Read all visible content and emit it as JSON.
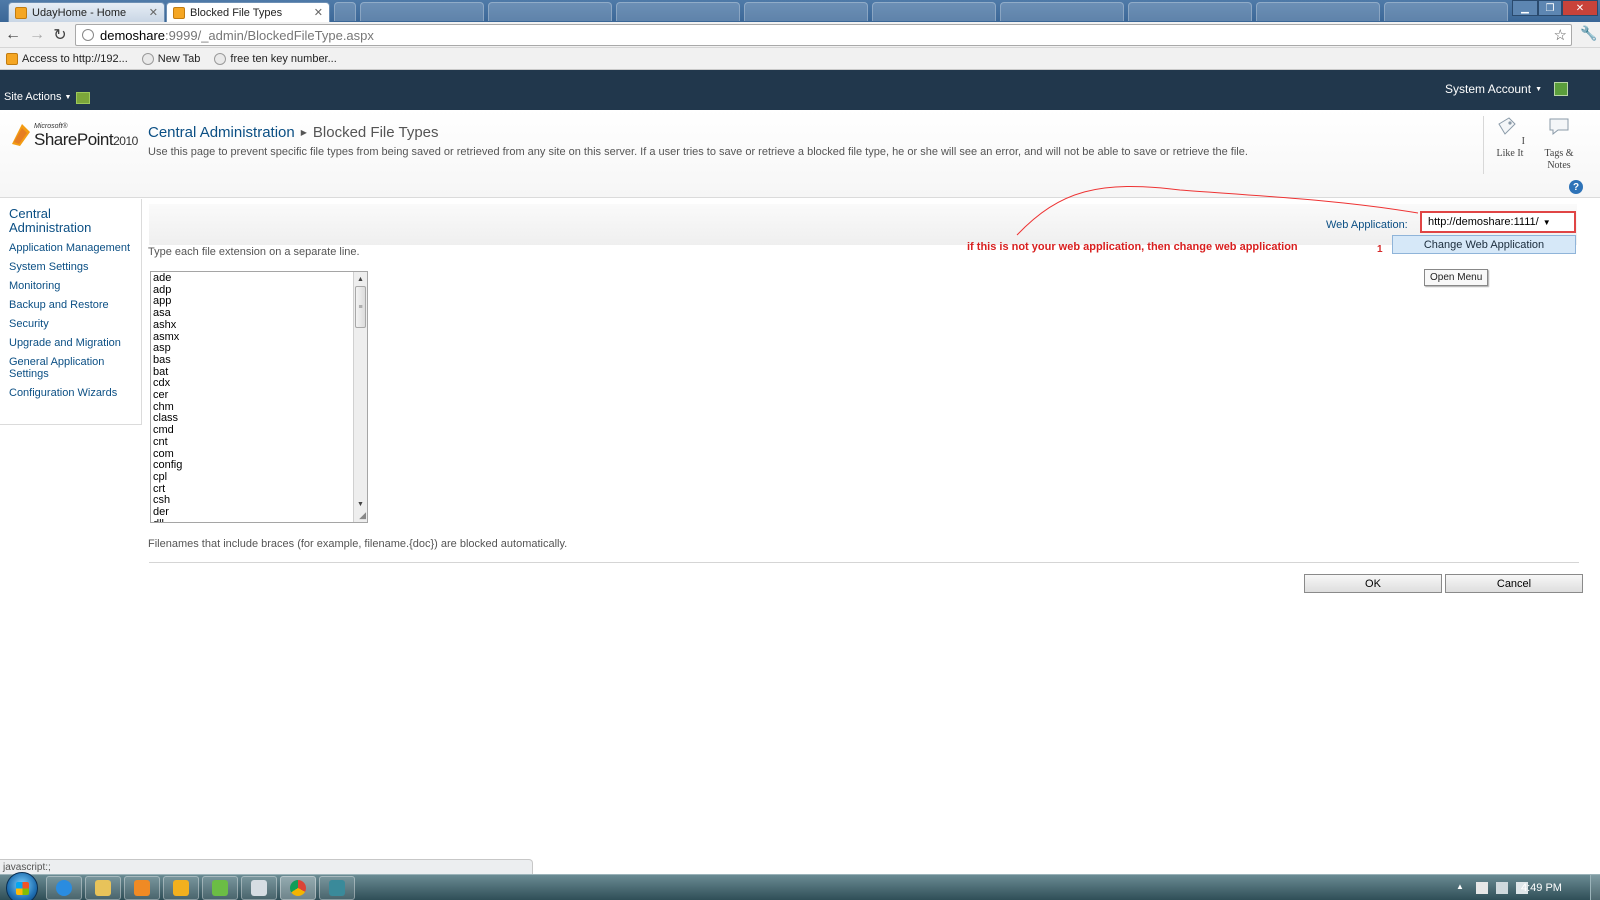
{
  "browser": {
    "tabs": [
      {
        "label": "UdayHome - Home",
        "active": false
      },
      {
        "label": "Blocked File Types",
        "active": true
      }
    ],
    "url_host": "demoshare",
    "url_path": ":9999/_admin/BlockedFileType.aspx",
    "bookmarks": [
      "Access to http://192...",
      "New Tab",
      "free ten key number..."
    ],
    "icons": {
      "back": "back-arrow-icon",
      "forward": "forward-arrow-icon",
      "reload": "reload-icon",
      "star": "star-icon",
      "wrench": "wrench-icon"
    }
  },
  "ribbon": {
    "site_actions": "Site Actions",
    "account": "System Account"
  },
  "header": {
    "logo_ms": "Microsoft®",
    "logo_sp": "SharePoint",
    "logo_year": "2010",
    "crumb_root": "Central Administration",
    "crumb_page": "Blocked File Types",
    "description": "Use this page to prevent specific file types from being saved or retrieved from any site on this server. If a user tries to save or retrieve a blocked file type, he or she will see an error, and will not be able to save or retrieve the file.",
    "i_like_it": "I Like It",
    "tags_line1": "Tags &",
    "tags_line2": "Notes",
    "help": "?"
  },
  "leftnav": {
    "heading_line1": "Central",
    "heading_line2": "Administration",
    "items": [
      "Application Management",
      "System Settings",
      "Monitoring",
      "Backup and Restore",
      "Security",
      "Upgrade and Migration",
      "General Application",
      "Settings",
      "Configuration Wizards"
    ]
  },
  "main": {
    "webapp_label": "Web Application:",
    "webapp_value": "http://demoshare:1111/",
    "menu_number": "1",
    "change_webapp": "Change Web Application",
    "open_menu": "Open Menu",
    "annotation": "if this is not your web application, then change web application",
    "instruction": "Type each file extension on a separate line.",
    "extensions": [
      "ade",
      "adp",
      "app",
      "asa",
      "ashx",
      "asmx",
      "asp",
      "bas",
      "bat",
      "cdx",
      "cer",
      "chm",
      "class",
      "cmd",
      "cnt",
      "com",
      "config",
      "cpl",
      "crt",
      "csh",
      "der",
      "dll"
    ],
    "braces_note": "Filenames that include braces (for example, filename.{doc}) are blocked automatically.",
    "ok": "OK",
    "cancel": "Cancel"
  },
  "status": {
    "text": "javascript:;"
  },
  "taskbar": {
    "clock": "4:49 PM"
  },
  "colors": {
    "ribbon": "#21374c",
    "link": "#0b4f84",
    "annotation": "#d81f1f",
    "selection": "#d6e8f8"
  }
}
